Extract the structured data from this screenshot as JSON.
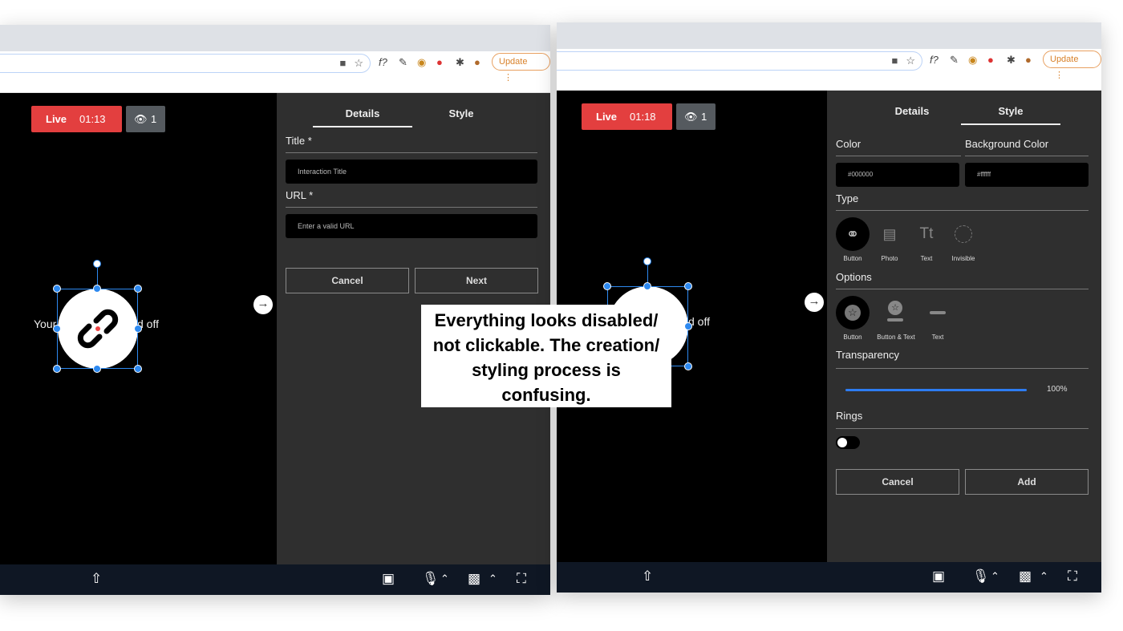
{
  "browser": {
    "update_label": "Update",
    "menu_label": "⋮",
    "omnibox_icons": [
      "video-camera-icon",
      "star-icon"
    ],
    "extensions": [
      "f?",
      "eyedropper",
      "extension-badge",
      "extension-red",
      "puzzle",
      "avatar"
    ]
  },
  "stream": {
    "live_label": "Live",
    "left_time": "01:13",
    "right_time": "01:18",
    "viewer_count": "1",
    "overlay_text_left": "Your",
    "overlay_text_right": "d off"
  },
  "left_panel": {
    "tabs": [
      {
        "label": "Details",
        "active": true
      },
      {
        "label": "Style",
        "active": false
      }
    ],
    "title_label": "Title *",
    "title_placeholder": "Interaction Title",
    "url_label": "URL *",
    "url_placeholder": "Enter a valid URL",
    "cancel_label": "Cancel",
    "next_label": "Next"
  },
  "right_panel": {
    "tabs": [
      {
        "label": "Details",
        "active": false
      },
      {
        "label": "Style",
        "active": true
      }
    ],
    "color_label": "Color",
    "color_value": "#000000",
    "bg_color_label": "Background Color",
    "bg_color_value": "#ffffff",
    "type_label": "Type",
    "types": [
      "Button",
      "Photo",
      "Text",
      "Invisible"
    ],
    "options_label": "Options",
    "options": [
      "Button",
      "Button & Text",
      "Text"
    ],
    "transparency_label": "Transparency",
    "transparency_value": "100%",
    "transparency_fraction": 1.0,
    "rings_label": "Rings",
    "rings_enabled": false,
    "cancel_label": "Cancel",
    "add_label": "Add"
  },
  "annotation": {
    "lines": [
      "Everything looks disabled/",
      "not clickable. The creation/",
      "styling process is",
      "confusing."
    ]
  },
  "colors": {
    "live_red": "#e33f3f",
    "panel_bg": "#2f2f2f",
    "bottom_bar": "#0f1724",
    "selection_blue": "#2d89f0",
    "update_orange": "#d9822b"
  }
}
